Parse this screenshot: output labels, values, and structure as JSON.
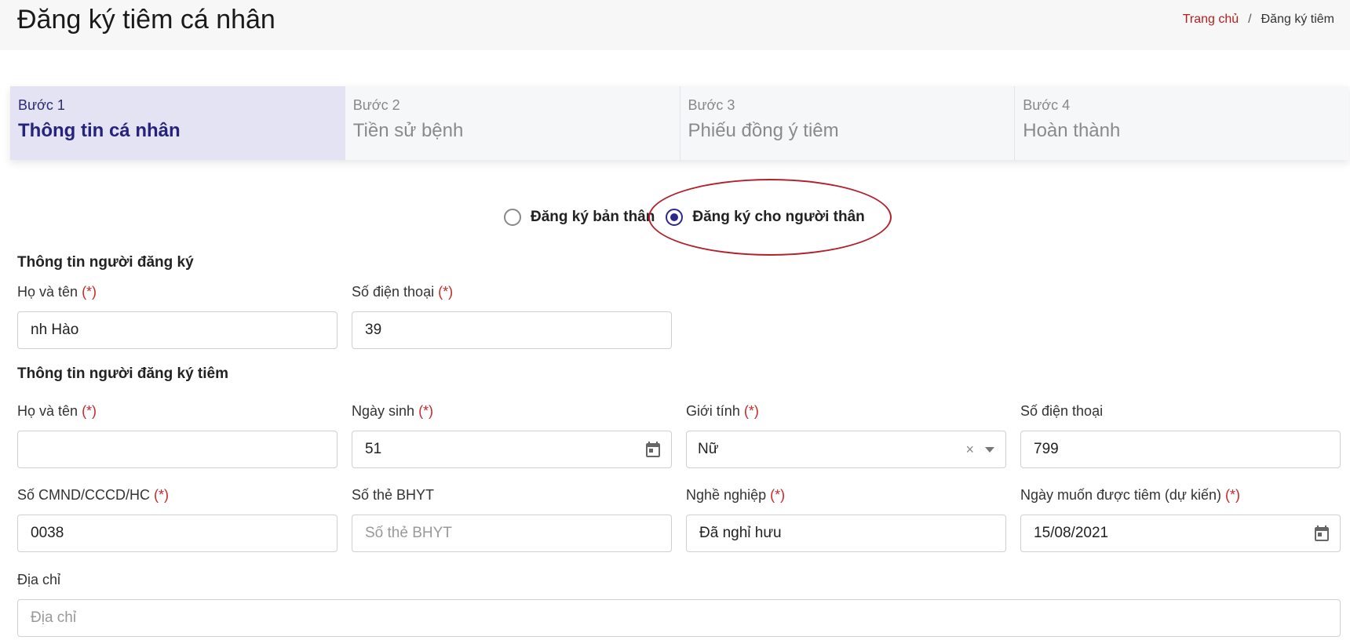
{
  "header": {
    "title": "Đăng ký tiêm cá nhân",
    "breadcrumb": {
      "home": "Trang chủ",
      "separator": "/",
      "current": "Đăng ký tiêm"
    }
  },
  "steps": [
    {
      "number": "Bước 1",
      "title": "Thông tin cá nhân",
      "active": true
    },
    {
      "number": "Bước 2",
      "title": "Tiền sử bệnh",
      "active": false
    },
    {
      "number": "Bước 3",
      "title": "Phiếu đồng ý tiêm",
      "active": false
    },
    {
      "number": "Bước 4",
      "title": "Hoàn thành",
      "active": false
    }
  ],
  "registration_type": {
    "options": [
      "Đăng ký bản thân",
      "Đăng ký cho người thân"
    ],
    "selected": "Đăng ký cho người thân"
  },
  "registrant": {
    "heading": "Thông tin người đăng ký",
    "full_name": {
      "label": "Họ và tên",
      "required": "(*)",
      "value": "nh Hào"
    },
    "phone": {
      "label": "Số điện thoại",
      "required": "(*)",
      "value": "39"
    }
  },
  "vaccinee": {
    "heading": "Thông tin người đăng ký tiêm",
    "full_name": {
      "label": "Họ và tên",
      "required": "(*)",
      "value": ""
    },
    "birth_date": {
      "label": "Ngày sinh",
      "required": "(*)",
      "value": "51"
    },
    "gender": {
      "label": "Giới tính",
      "required": "(*)",
      "value": "Nữ",
      "clear": "×"
    },
    "phone": {
      "label": "Số điện thoại",
      "value": "799"
    },
    "id_number": {
      "label": "Số CMND/CCCD/HC",
      "required": "(*)",
      "value": "0038"
    },
    "insurance": {
      "label": "Số thẻ BHYT",
      "value": "",
      "placeholder": "Số thẻ BHYT"
    },
    "occupation": {
      "label": "Nghề nghiệp",
      "required": "(*)",
      "value": "Đã nghỉ hưu"
    },
    "desired_date": {
      "label": "Ngày muốn được tiêm (dự kiến)",
      "required": "(*)",
      "value": "15/08/2021"
    },
    "address": {
      "label": "Địa chỉ",
      "value": "",
      "placeholder": "Địa chỉ"
    }
  },
  "colors": {
    "accent": "#2a2a8c",
    "active_step_bg": "#e4e3f4",
    "required": "#c62828",
    "breadcrumb_link": "#b71c1c",
    "annotation": "#b3202c"
  }
}
